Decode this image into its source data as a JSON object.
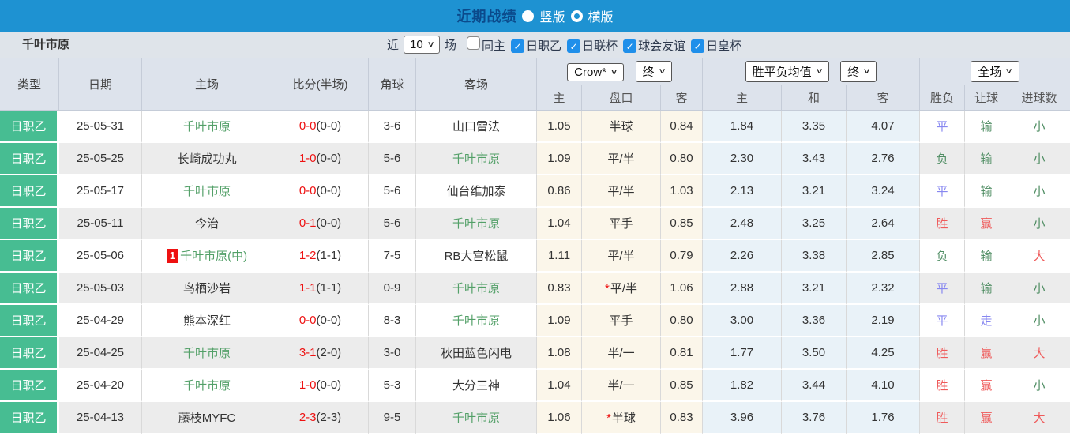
{
  "colors": {
    "bar_blue": "#1e92d2",
    "title_navy": "#0b4a8b",
    "checkbox_blue": "#1f8fea",
    "type_green": "#47bd92",
    "team_green": "#53a068",
    "score_red": "#ee1111",
    "result_red": "#ef5a5a",
    "result_green": "#4f8d63",
    "result_blue": "#8787f0",
    "bg_cream": "#fbf6ea",
    "bg_lightblue": "#e9f2f8"
  },
  "topbar": {
    "title": "近期战绩",
    "radios": [
      {
        "label": "竖版",
        "selected": true
      },
      {
        "label": "横版",
        "selected": false
      }
    ]
  },
  "filter": {
    "team": "千叶市原",
    "recent_label": "近",
    "recent_value": "10",
    "matches_label": "场",
    "checkboxes": [
      {
        "label": "同主",
        "checked": false
      },
      {
        "label": "日职乙",
        "checked": true
      },
      {
        "label": "日联杯",
        "checked": true
      },
      {
        "label": "球会友谊",
        "checked": true
      },
      {
        "label": "日皇杯",
        "checked": true
      }
    ]
  },
  "table": {
    "static_headers": [
      "类型",
      "日期",
      "主场",
      "比分(半场)",
      "角球",
      "客场"
    ],
    "groups": [
      {
        "selects": [
          "Crow*",
          "终"
        ],
        "subs": [
          "主",
          "盘口",
          "客"
        ]
      },
      {
        "selects": [
          "胜平负均值",
          "终"
        ],
        "subs": [
          "主",
          "和",
          "客"
        ]
      },
      {
        "selects": [
          "全场"
        ],
        "subs": [
          "胜负",
          "让球",
          "进球数"
        ]
      }
    ],
    "rows": [
      {
        "league": "日职乙",
        "date": "25-05-31",
        "home": "千叶市原",
        "home_green": true,
        "badge": "",
        "away": "山口雷法",
        "away_green": false,
        "score": "0-0",
        "half": "(0-0)",
        "corner": "3-6",
        "odds_home": "1.05",
        "handicap": "半球",
        "star": false,
        "odds_away": "0.84",
        "avg_home": "1.84",
        "avg_draw": "3.35",
        "avg_away": "4.07",
        "outcome": {
          "text": "平",
          "cls": "blue"
        },
        "cover": {
          "text": "输",
          "cls": "green"
        },
        "goals": {
          "text": "小",
          "cls": "green"
        }
      },
      {
        "league": "日职乙",
        "date": "25-05-25",
        "home": "长崎成功丸",
        "home_green": false,
        "badge": "",
        "away": "千叶市原",
        "away_green": true,
        "score": "1-0",
        "half": "(0-0)",
        "corner": "5-6",
        "odds_home": "1.09",
        "handicap": "平/半",
        "star": false,
        "odds_away": "0.80",
        "avg_home": "2.30",
        "avg_draw": "3.43",
        "avg_away": "2.76",
        "outcome": {
          "text": "负",
          "cls": "green"
        },
        "cover": {
          "text": "输",
          "cls": "green"
        },
        "goals": {
          "text": "小",
          "cls": "green"
        }
      },
      {
        "league": "日职乙",
        "date": "25-05-17",
        "home": "千叶市原",
        "home_green": true,
        "badge": "",
        "away": "仙台维加泰",
        "away_green": false,
        "score": "0-0",
        "half": "(0-0)",
        "corner": "5-6",
        "odds_home": "0.86",
        "handicap": "平/半",
        "star": false,
        "odds_away": "1.03",
        "avg_home": "2.13",
        "avg_draw": "3.21",
        "avg_away": "3.24",
        "outcome": {
          "text": "平",
          "cls": "blue"
        },
        "cover": {
          "text": "输",
          "cls": "green"
        },
        "goals": {
          "text": "小",
          "cls": "green"
        }
      },
      {
        "league": "日职乙",
        "date": "25-05-11",
        "home": "今治",
        "home_green": false,
        "badge": "",
        "away": "千叶市原",
        "away_green": true,
        "score": "0-1",
        "half": "(0-0)",
        "corner": "5-6",
        "odds_home": "1.04",
        "handicap": "平手",
        "star": false,
        "odds_away": "0.85",
        "avg_home": "2.48",
        "avg_draw": "3.25",
        "avg_away": "2.64",
        "outcome": {
          "text": "胜",
          "cls": "red"
        },
        "cover": {
          "text": "赢",
          "cls": "red"
        },
        "goals": {
          "text": "小",
          "cls": "green"
        }
      },
      {
        "league": "日职乙",
        "date": "25-05-06",
        "home": "千叶市原(中)",
        "home_green": true,
        "badge": "1",
        "away": "RB大宫松鼠",
        "away_green": false,
        "score": "1-2",
        "half": "(1-1)",
        "corner": "7-5",
        "odds_home": "1.11",
        "handicap": "平/半",
        "star": false,
        "odds_away": "0.79",
        "avg_home": "2.26",
        "avg_draw": "3.38",
        "avg_away": "2.85",
        "outcome": {
          "text": "负",
          "cls": "green"
        },
        "cover": {
          "text": "输",
          "cls": "green"
        },
        "goals": {
          "text": "大",
          "cls": "red"
        }
      },
      {
        "league": "日职乙",
        "date": "25-05-03",
        "home": "鸟栖沙岩",
        "home_green": false,
        "badge": "",
        "away": "千叶市原",
        "away_green": true,
        "score": "1-1",
        "half": "(1-1)",
        "corner": "0-9",
        "odds_home": "0.83",
        "handicap": "平/半",
        "star": true,
        "odds_away": "1.06",
        "avg_home": "2.88",
        "avg_draw": "3.21",
        "avg_away": "2.32",
        "outcome": {
          "text": "平",
          "cls": "blue"
        },
        "cover": {
          "text": "输",
          "cls": "green"
        },
        "goals": {
          "text": "小",
          "cls": "green"
        }
      },
      {
        "league": "日职乙",
        "date": "25-04-29",
        "home": "熊本深红",
        "home_green": false,
        "badge": "",
        "away": "千叶市原",
        "away_green": true,
        "score": "0-0",
        "half": "(0-0)",
        "corner": "8-3",
        "odds_home": "1.09",
        "handicap": "平手",
        "star": false,
        "odds_away": "0.80",
        "avg_home": "3.00",
        "avg_draw": "3.36",
        "avg_away": "2.19",
        "outcome": {
          "text": "平",
          "cls": "blue"
        },
        "cover": {
          "text": "走",
          "cls": "blue"
        },
        "goals": {
          "text": "小",
          "cls": "green"
        }
      },
      {
        "league": "日职乙",
        "date": "25-04-25",
        "home": "千叶市原",
        "home_green": true,
        "badge": "",
        "away": "秋田蓝色闪电",
        "away_green": false,
        "score": "3-1",
        "half": "(2-0)",
        "corner": "3-0",
        "odds_home": "1.08",
        "handicap": "半/一",
        "star": false,
        "odds_away": "0.81",
        "avg_home": "1.77",
        "avg_draw": "3.50",
        "avg_away": "4.25",
        "outcome": {
          "text": "胜",
          "cls": "red"
        },
        "cover": {
          "text": "赢",
          "cls": "red"
        },
        "goals": {
          "text": "大",
          "cls": "red"
        }
      },
      {
        "league": "日职乙",
        "date": "25-04-20",
        "home": "千叶市原",
        "home_green": true,
        "badge": "",
        "away": "大分三神",
        "away_green": false,
        "score": "1-0",
        "half": "(0-0)",
        "corner": "5-3",
        "odds_home": "1.04",
        "handicap": "半/一",
        "star": false,
        "odds_away": "0.85",
        "avg_home": "1.82",
        "avg_draw": "3.44",
        "avg_away": "4.10",
        "outcome": {
          "text": "胜",
          "cls": "red"
        },
        "cover": {
          "text": "赢",
          "cls": "red"
        },
        "goals": {
          "text": "小",
          "cls": "green"
        }
      },
      {
        "league": "日职乙",
        "date": "25-04-13",
        "home": "藤枝MYFC",
        "home_green": false,
        "badge": "",
        "away": "千叶市原",
        "away_green": true,
        "score": "2-3",
        "half": "(2-3)",
        "corner": "9-5",
        "odds_home": "1.06",
        "handicap": "半球",
        "star": true,
        "odds_away": "0.83",
        "avg_home": "3.96",
        "avg_draw": "3.76",
        "avg_away": "1.76",
        "outcome": {
          "text": "胜",
          "cls": "red"
        },
        "cover": {
          "text": "赢",
          "cls": "red"
        },
        "goals": {
          "text": "大",
          "cls": "red"
        }
      }
    ]
  }
}
